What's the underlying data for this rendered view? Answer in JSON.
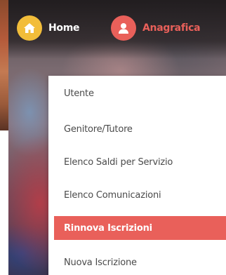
{
  "nav": {
    "home": {
      "label": "Home",
      "icon": "home-icon",
      "color": "#f2bd3a"
    },
    "anagrafica": {
      "label": "Anagrafica",
      "icon": "user-icon",
      "color": "#e9605a"
    }
  },
  "menu": {
    "items": [
      {
        "label": "Utente",
        "active": false
      },
      {
        "label": "Genitore/Tutore",
        "active": false
      },
      {
        "label": "Elenco Saldi per Servizio",
        "active": false
      },
      {
        "label": "Elenco Comunicazioni",
        "active": false
      },
      {
        "label": "Rinnova Iscrizioni",
        "active": true
      },
      {
        "label": "Nuova Iscrizione",
        "active": false
      }
    ],
    "active_color": "#e9605a"
  }
}
